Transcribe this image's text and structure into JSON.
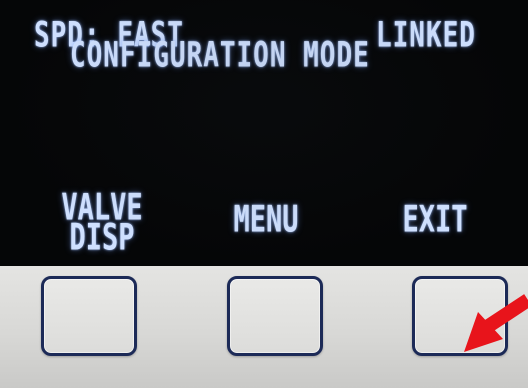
{
  "display": {
    "speed": "SPD: FAST",
    "link_status": "LINKED",
    "mode": "CONFIGURATION MODE"
  },
  "softkeys": [
    {
      "line1": "VALVE",
      "line2": "DISP"
    },
    {
      "line1": "MENU"
    },
    {
      "line1": "EXIT"
    }
  ],
  "colors": {
    "screen_bg": "#050607",
    "oled_text": "#cfe0ff",
    "button_border": "#1c2a57",
    "annotation_arrow": "#e8141b"
  },
  "icons": {
    "annotation": "red-arrow-icon"
  }
}
